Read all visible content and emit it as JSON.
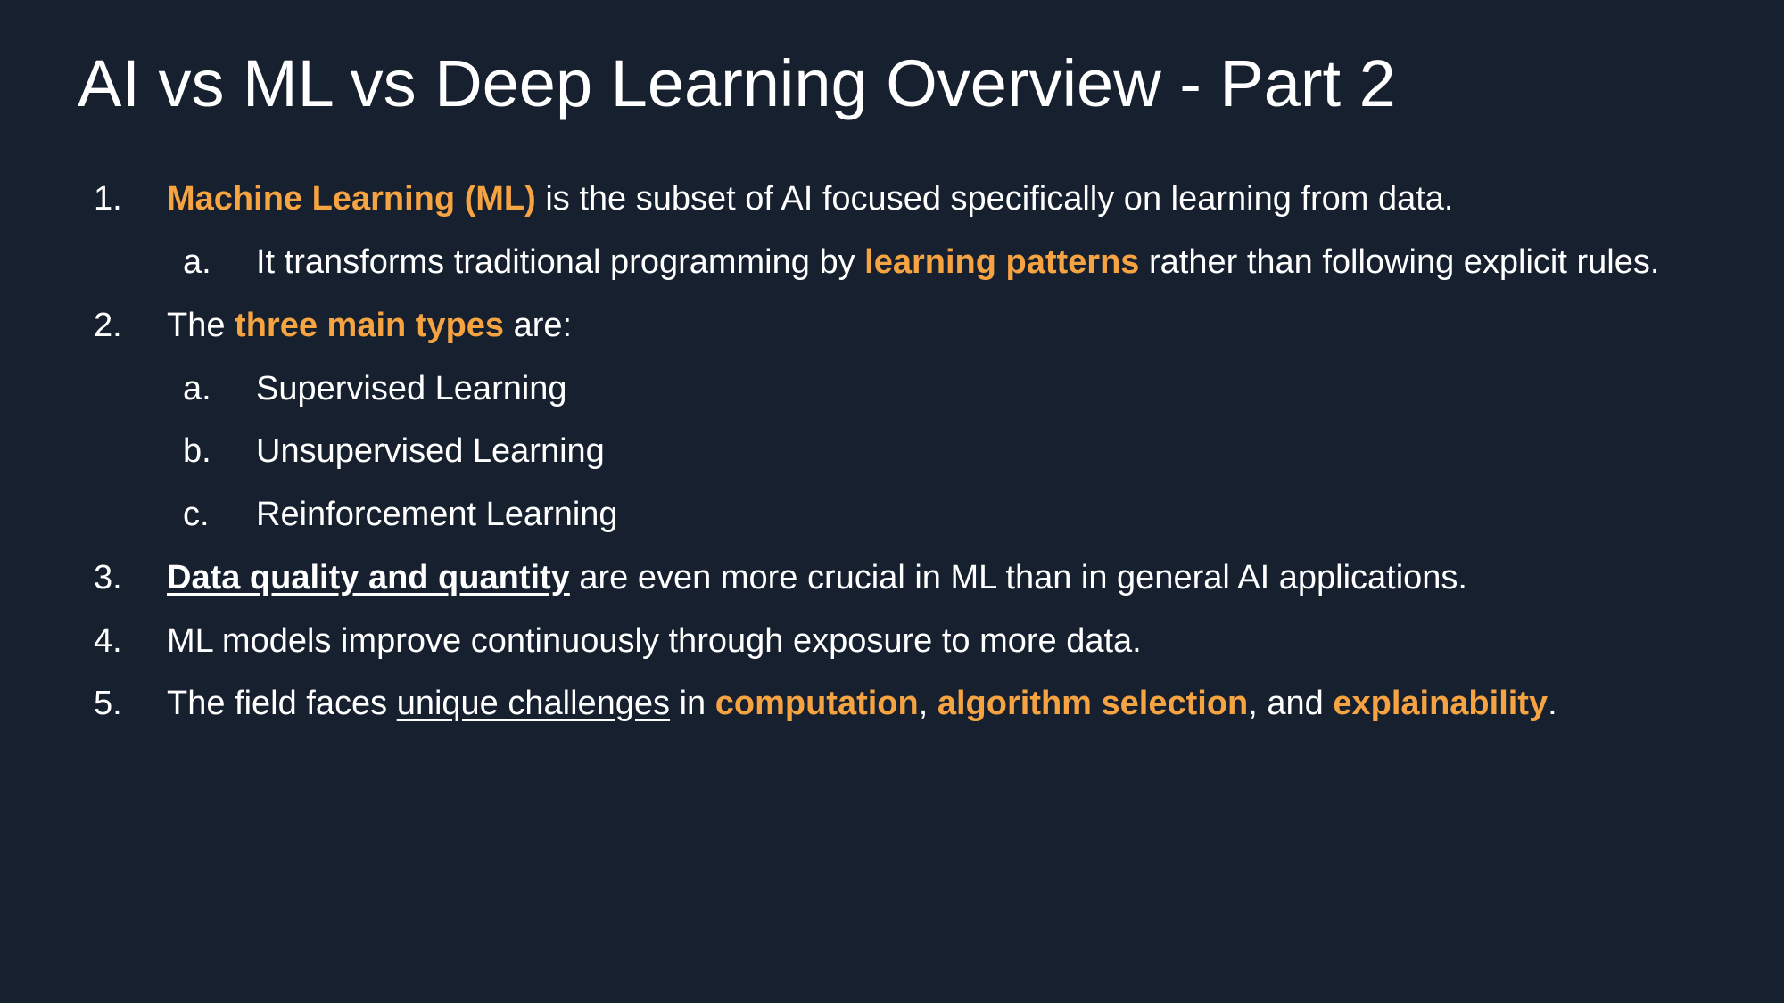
{
  "slide": {
    "title": "AI vs ML vs Deep Learning Overview - Part 2",
    "colors": {
      "background": "#16202e",
      "text": "#ffffff",
      "accent": "#f6a342"
    },
    "items": [
      {
        "marker": "1.",
        "parts": [
          "Machine Learning (ML)",
          " is the subset of AI focused specifically on learning from data."
        ]
      },
      {
        "marker": "a.",
        "parts": [
          "It transforms traditional programming by ",
          "learning patterns",
          " rather than following explicit rules."
        ]
      },
      {
        "marker": "2.",
        "parts": [
          "The ",
          "three main types",
          " are:"
        ]
      },
      {
        "marker": "a.",
        "parts": [
          "Supervised Learning"
        ]
      },
      {
        "marker": "b.",
        "parts": [
          "Unsupervised Learning"
        ]
      },
      {
        "marker": "c.",
        "parts": [
          "Reinforcement Learning"
        ]
      },
      {
        "marker": "3.",
        "parts": [
          "Data quality and quantity",
          " are even more crucial in ML than in general AI applications."
        ]
      },
      {
        "marker": "4.",
        "parts": [
          "ML models improve continuously through exposure to more data."
        ]
      },
      {
        "marker": "5.",
        "parts": [
          "The field faces ",
          "unique challenges",
          " in ",
          "computation",
          ", ",
          "algorithm selection",
          ", and ",
          "explainability",
          "."
        ]
      }
    ]
  }
}
